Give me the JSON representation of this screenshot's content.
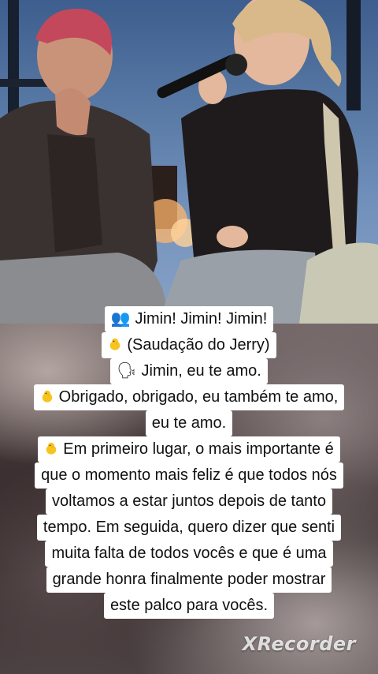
{
  "video": {
    "description_icons": [
      "crowd-icon",
      "chick-icon",
      "speaking-head-icon"
    ]
  },
  "caption": {
    "line1": {
      "icon": "👥",
      "text": "Jimin! Jimin! Jimin!"
    },
    "line2": {
      "icon": "chick",
      "text": "(Saudação do Jerry)"
    },
    "line3": {
      "icon": "🗣",
      "text": "Jimin, eu te amo."
    },
    "block4": [
      {
        "icon": "chick",
        "text": "Obrigado, obrigado, eu também te amo,"
      },
      {
        "icon": "",
        "text": "eu te amo."
      }
    ],
    "block5": [
      {
        "icon": "chick",
        "text": "Em primeiro lugar, o mais importante é"
      },
      {
        "icon": "",
        "text": "que o momento mais feliz é que todos nós"
      },
      {
        "icon": "",
        "text": "voltamos a estar juntos depois de tanto"
      },
      {
        "icon": "",
        "text": "tempo. Em seguida, quero dizer que senti"
      },
      {
        "icon": "",
        "text": "muita falta de todos vocês e que é uma"
      },
      {
        "icon": "",
        "text": "grande honra finalmente poder mostrar"
      },
      {
        "icon": "",
        "text": "este palco para vocês."
      }
    ]
  },
  "watermark": {
    "text": "XRecorder"
  },
  "colors": {
    "caption_bg": "#ffffff",
    "caption_text": "#111111",
    "chick": "#f7c41f"
  }
}
